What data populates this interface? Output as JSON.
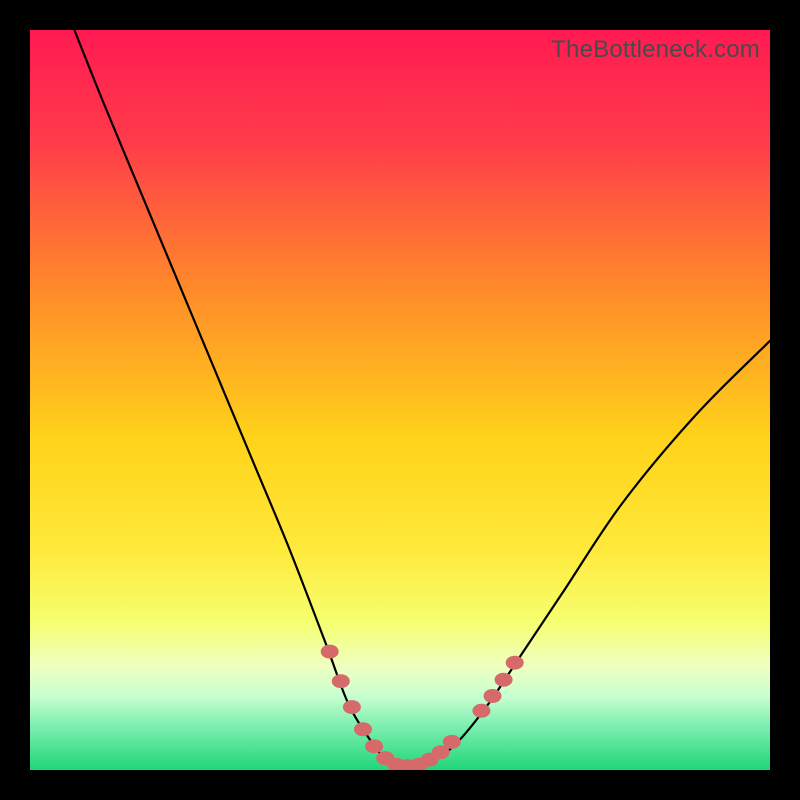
{
  "watermark": "TheBottleneck.com",
  "chart_data": {
    "type": "line",
    "title": "",
    "xlabel": "",
    "ylabel": "",
    "xlim": [
      0,
      100
    ],
    "ylim": [
      0,
      100
    ],
    "grid": false,
    "legend": false,
    "gradient_stops": [
      {
        "offset": 0.0,
        "color": "#ff1a52"
      },
      {
        "offset": 0.15,
        "color": "#ff3b4a"
      },
      {
        "offset": 0.35,
        "color": "#ff8a2a"
      },
      {
        "offset": 0.55,
        "color": "#ffd21a"
      },
      {
        "offset": 0.7,
        "color": "#ffe93a"
      },
      {
        "offset": 0.8,
        "color": "#f6ff70"
      },
      {
        "offset": 0.86,
        "color": "#eeffc0"
      },
      {
        "offset": 0.9,
        "color": "#c8ffd0"
      },
      {
        "offset": 0.94,
        "color": "#7eefb0"
      },
      {
        "offset": 1.0,
        "color": "#20d67a"
      }
    ],
    "series": [
      {
        "name": "bottleneck-curve",
        "color": "#000000",
        "x": [
          6,
          10,
          15,
          20,
          25,
          30,
          35,
          40,
          43,
          46,
          48,
          50,
          52,
          55,
          58,
          62,
          66,
          72,
          80,
          90,
          100
        ],
        "y": [
          100,
          90,
          78,
          66,
          54,
          42,
          30,
          17,
          9,
          4,
          1.5,
          0.5,
          0.5,
          1.5,
          4,
          9,
          15,
          24,
          36,
          48,
          58
        ]
      }
    ],
    "markers": {
      "name": "highlight-beads",
      "color": "#d66a6a",
      "points": [
        {
          "x": 40.5,
          "y": 16
        },
        {
          "x": 42.0,
          "y": 12
        },
        {
          "x": 43.5,
          "y": 8.5
        },
        {
          "x": 45.0,
          "y": 5.5
        },
        {
          "x": 46.5,
          "y": 3.2
        },
        {
          "x": 48.0,
          "y": 1.6
        },
        {
          "x": 49.5,
          "y": 0.7
        },
        {
          "x": 51.0,
          "y": 0.5
        },
        {
          "x": 52.5,
          "y": 0.7
        },
        {
          "x": 54.0,
          "y": 1.4
        },
        {
          "x": 55.5,
          "y": 2.4
        },
        {
          "x": 57.0,
          "y": 3.8
        },
        {
          "x": 61.0,
          "y": 8.0
        },
        {
          "x": 62.5,
          "y": 10.0
        },
        {
          "x": 64.0,
          "y": 12.2
        },
        {
          "x": 65.5,
          "y": 14.5
        }
      ]
    }
  }
}
